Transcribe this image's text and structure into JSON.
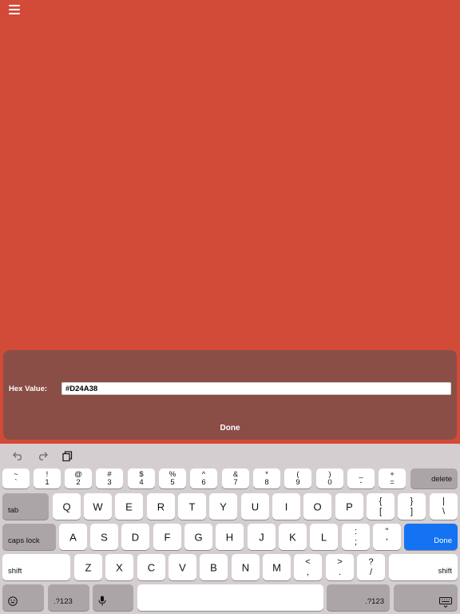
{
  "colors": {
    "background": "#D24A38",
    "panel": "#8A4E47",
    "done_key": "#1473F2"
  },
  "header": {
    "menu_icon": "hamburger-menu-icon"
  },
  "panel": {
    "hex_label": "Hex Value:",
    "hex_value": "#D24A38",
    "done_label": "Done"
  },
  "keyboard": {
    "toolbar": {
      "undo_icon": "undo-icon",
      "redo_icon": "redo-icon",
      "paste_icon": "paste-icon"
    },
    "number_row": [
      {
        "top": "~",
        "bot": "`"
      },
      {
        "top": "!",
        "bot": "1"
      },
      {
        "top": "@",
        "bot": "2"
      },
      {
        "top": "#",
        "bot": "3"
      },
      {
        "top": "$",
        "bot": "4"
      },
      {
        "top": "%",
        "bot": "5"
      },
      {
        "top": "^",
        "bot": "6"
      },
      {
        "top": "&",
        "bot": "7"
      },
      {
        "top": "*",
        "bot": "8"
      },
      {
        "top": "(",
        "bot": "9"
      },
      {
        "top": ")",
        "bot": "0"
      },
      {
        "top": "_",
        "bot": "-"
      },
      {
        "top": "+",
        "bot": "="
      }
    ],
    "delete_label": "delete",
    "tab_label": "tab",
    "row_q": [
      "Q",
      "W",
      "E",
      "R",
      "T",
      "Y",
      "U",
      "I",
      "O",
      "P"
    ],
    "row_q_symbols": [
      {
        "top": "{",
        "bot": "["
      },
      {
        "top": "}",
        "bot": "]"
      },
      {
        "top": "|",
        "bot": "\\"
      }
    ],
    "caps_label": "caps lock",
    "row_a": [
      "A",
      "S",
      "D",
      "F",
      "G",
      "H",
      "J",
      "K",
      "L"
    ],
    "row_a_symbols": [
      {
        "top": ":",
        "bot": ";"
      },
      {
        "top": "\"",
        "bot": "'"
      }
    ],
    "done_label": "Done",
    "shift_label": "shift",
    "row_z": [
      "Z",
      "X",
      "C",
      "V",
      "B",
      "N",
      "M"
    ],
    "row_z_symbols": [
      {
        "top": "<",
        "bot": ","
      },
      {
        "top": ">",
        "bot": "."
      },
      {
        "top": "?",
        "bot": "/"
      }
    ],
    "numbers_label": ".?123",
    "emoji_icon": "emoji-icon",
    "mic_icon": "microphone-icon",
    "dismiss_icon": "keyboard-dismiss-icon"
  }
}
